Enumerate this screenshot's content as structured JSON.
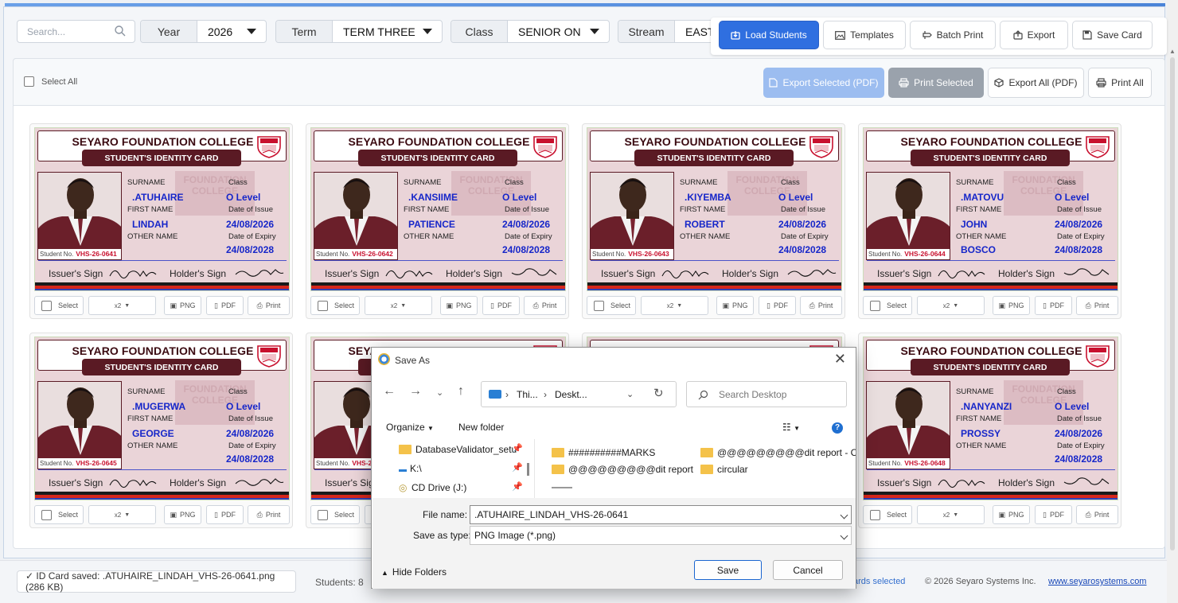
{
  "filters": {
    "search_placeholder": "Search...",
    "year": {
      "label": "Year",
      "value": "2026"
    },
    "term": {
      "label": "Term",
      "value": "TERM THREE"
    },
    "class": {
      "label": "Class",
      "value": "SENIOR ON"
    },
    "stream": {
      "label": "Stream",
      "value": "EAST"
    }
  },
  "toolbar": {
    "load": "Load Students",
    "templates": "Templates",
    "batch_print": "Batch Print",
    "export": "Export",
    "save_card": "Save Card"
  },
  "selection": {
    "select_all": "Select All",
    "export_selected": "Export Selected (PDF)",
    "print_selected": "Print Selected",
    "export_all": "Export All (PDF)",
    "print_all": "Print All"
  },
  "card_template": {
    "school": "SEYARO FOUNDATION COLLEGE",
    "banner": "STUDENT'S IDENTITY CARD",
    "watermark_1": "FOUNDATION",
    "watermark_2": "COLLEGE",
    "surname_label": "SURNAME",
    "first_label": "FIRST NAME",
    "other_label": "OTHER NAME",
    "class_label": "Class",
    "issue_label": "Date of Issue",
    "expiry_label": "Date of Expiry",
    "student_no_label": "Student No.",
    "issuer_sign": "Issuer's Sign",
    "holder_sign": "Holder's Sign",
    "stripe_colors": [
      "#1a1a1a",
      "#d6261b",
      "#2f3fb8",
      "#2e9a3c"
    ]
  },
  "card_controls": {
    "select": "Select",
    "copies": "x2",
    "png": "PNG",
    "pdf": "PDF",
    "print": "Print"
  },
  "cards": [
    {
      "surname": ".ATUHAIRE",
      "first": "LINDAH",
      "other": "",
      "class": "O Level",
      "issue": "24/08/2026",
      "expiry": "24/08/2028",
      "student_no": "VHS-26-0641"
    },
    {
      "surname": ".KANSIIME",
      "first": "PATIENCE",
      "other": "",
      "class": "O Level",
      "issue": "24/08/2026",
      "expiry": "24/08/2028",
      "student_no": "VHS-26-0642"
    },
    {
      "surname": ".KIYEMBA",
      "first": "ROBERT",
      "other": "",
      "class": "O Level",
      "issue": "24/08/2026",
      "expiry": "24/08/2028",
      "student_no": "VHS-26-0643"
    },
    {
      "surname": ".MATOVU",
      "first": "JOHN",
      "other": "BOSCO",
      "class": "O Level",
      "issue": "24/08/2026",
      "expiry": "24/08/2028",
      "student_no": "VHS-26-0644"
    },
    {
      "surname": ".MUGERWA",
      "first": "GEORGE",
      "other": "",
      "class": "O Level",
      "issue": "24/08/2026",
      "expiry": "24/08/2028",
      "student_no": "VHS-26-0645"
    },
    {
      "surname": "",
      "first": "",
      "other": "",
      "class": "",
      "issue": "",
      "expiry": "",
      "student_no": "VHS-2"
    },
    {
      "surname": "",
      "first": "",
      "other": "",
      "class": "",
      "issue": "",
      "expiry": "",
      "student_no": ""
    },
    {
      "surname": ".NANYANZI",
      "first": "PROSSY",
      "other": "",
      "class": "O Level",
      "issue": "24/08/2026",
      "expiry": "24/08/2028",
      "student_no": "VHS-26-0648"
    }
  ],
  "status": {
    "message": "✓ ID Card saved: .ATUHAIRE_LINDAH_VHS-26-0641.png (286 KB)",
    "students": "Students: 8",
    "cards_selected": "ards selected",
    "copyright": "© 2026 Seyaro Systems Inc.",
    "link": "www.seyarosystems.com"
  },
  "dialog": {
    "title": "Save As",
    "path_1": "Thi...",
    "path_2": "Deskt...",
    "search_placeholder": "Search Desktop",
    "organize": "Organize",
    "new_folder": "New folder",
    "nav_items": [
      "DatabaseValidator_setu",
      "K:\\",
      "CD Drive (J:)"
    ],
    "files": [
      "##########MARKS",
      "@@@@@@@@@dit report - Cop",
      "@@@@@@@@@dit report",
      "circular"
    ],
    "file_name_label": "File name:",
    "file_name_value": ".ATUHAIRE_LINDAH_VHS-26-0641",
    "save_type_label": "Save as type:",
    "save_type_value": "PNG Image (*.png)",
    "hide_folders": "Hide Folders",
    "save": "Save",
    "cancel": "Cancel"
  }
}
